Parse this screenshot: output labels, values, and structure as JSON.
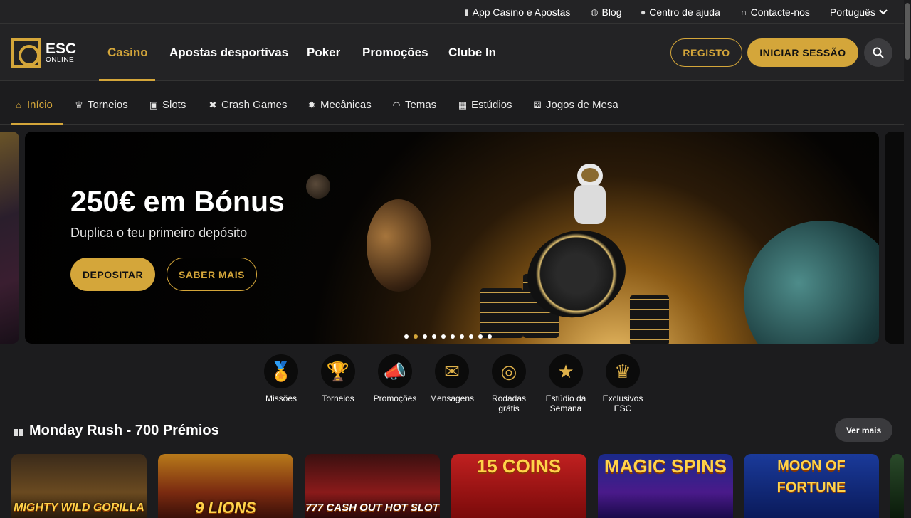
{
  "topbar": {
    "app_label": "App Casino e Apostas",
    "blog_label": "Blog",
    "help_label": "Centro de ajuda",
    "contact_label": "Contacte-nos",
    "language_label": "Português"
  },
  "header": {
    "logo_main": "ESC",
    "logo_sub": "ONLINE",
    "nav": [
      "Casino",
      "Apostas desportivas",
      "Poker",
      "Promoções",
      "Clube In"
    ],
    "active_nav": "Casino",
    "register_label": "REGISTO",
    "login_label": "INICIAR SESSÃO"
  },
  "subnav": {
    "items": [
      {
        "label": "Início",
        "icon": "home-icon"
      },
      {
        "label": "Torneios",
        "icon": "trophy-icon"
      },
      {
        "label": "Slots",
        "icon": "slot-machine-icon"
      },
      {
        "label": "Crash Games",
        "icon": "crash-icon"
      },
      {
        "label": "Mecânicas",
        "icon": "gear-icon"
      },
      {
        "label": "Temas",
        "icon": "mask-icon"
      },
      {
        "label": "Estúdios",
        "icon": "store-icon"
      },
      {
        "label": "Jogos de Mesa",
        "icon": "dice-icon"
      }
    ]
  },
  "banner": {
    "title": "250€ em Bónus",
    "subtitle": "Duplica o teu primeiro depósito",
    "primary_button": "DEPOSITAR",
    "secondary_button": "SABER MAIS",
    "slide_count": 10,
    "active_slide": 2
  },
  "quick_links": [
    {
      "label": "Missões",
      "icon": "medal-icon"
    },
    {
      "label": "Torneios",
      "icon": "trophy-icon"
    },
    {
      "label": "Promoções",
      "icon": "megaphone-icon"
    },
    {
      "label": "Mensagens",
      "icon": "envelope-icon"
    },
    {
      "label": "Rodadas grátis",
      "icon": "coin-icon"
    },
    {
      "label": "Estúdio da Semana",
      "icon": "star-icon"
    },
    {
      "label": "Exclusivos ESC",
      "icon": "crown-icon"
    }
  ],
  "section": {
    "title": "Monday Rush - 700 Prémios",
    "see_more": "Ver mais"
  },
  "games": [
    {
      "name": "MIGHTY WILD GORILLA"
    },
    {
      "name": "9 LIONS"
    },
    {
      "name": "777 CASH OUT HOT SLOT"
    },
    {
      "name": "15 COINS"
    },
    {
      "name": "MAGIC SPINS"
    },
    {
      "name": "MOON OF FORTUNE"
    }
  ],
  "colors": {
    "accent": "#d4a63a",
    "background": "#1c1c1e",
    "header": "#232325"
  }
}
